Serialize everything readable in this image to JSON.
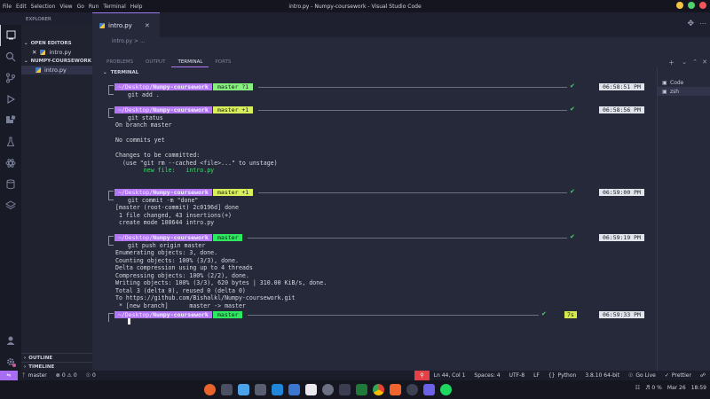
{
  "window": {
    "title": "intro.py - Numpy-coursework - Visual Studio Code"
  },
  "menu": [
    "File",
    "Edit",
    "Selection",
    "View",
    "Go",
    "Run",
    "Terminal",
    "Help"
  ],
  "sidebar": {
    "header": "EXPLORER",
    "open_editors_label": "OPEN EDITORS",
    "open_editor_file": "intro.py",
    "workspace_label": "NUMPY-COURSEWORK",
    "workspace_file": "intro.py",
    "outline_label": "OUTLINE",
    "timeline_label": "TIMELINE"
  },
  "editor": {
    "tab_label": "intro.py",
    "breadcrumb": "intro.py > ..."
  },
  "panel": {
    "tabs": [
      "PROBLEMS",
      "OUTPUT",
      "TERMINAL",
      "PORTS"
    ],
    "active_tab": "TERMINAL",
    "terminal_label": "TERMINAL",
    "terminal_list": [
      "Code",
      "zsh"
    ]
  },
  "terminal": {
    "prompt_dir_prefix": "~/Desktop/",
    "prompt_dir_repo": "Numpy-coursework",
    "blocks": [
      {
        "git": "master ?1",
        "git_color": "#86f07c",
        "time": "06:58:51 PM",
        "command": "git add .",
        "output": []
      },
      {
        "git": "master +1",
        "git_color": "#d8ef5a",
        "time": "06:58:56 PM",
        "command": "git status",
        "output": [
          "On branch master",
          "",
          "No commits yet",
          "",
          "Changes to be committed:",
          "  (use \"git rm --cached <file>...\" to unstage)",
          "        new file:   intro.py"
        ]
      },
      {
        "git": "master +1",
        "git_color": "#d8ef5a",
        "time": "06:59:00 PM",
        "command": "git commit -m \"done\"",
        "output": [
          "[master (root-commit) 2c0196d] done",
          " 1 file changed, 43 insertions(+)",
          " create mode 100644 intro.py"
        ]
      },
      {
        "git": "master",
        "git_color": "#2ee85f",
        "time": "06:59:19 PM",
        "command": "git push origin master",
        "output": [
          "Enumerating objects: 3, done.",
          "Counting objects: 100% (3/3), done.",
          "Delta compression using up to 4 threads",
          "Compressing objects: 100% (2/2), done.",
          "Writing objects: 100% (3/3), 620 bytes | 310.00 KiB/s, done.",
          "Total 3 (delta 0), reused 0 (delta 0)",
          "To https://github.com/Bishalkl/Numpy-coursework.git",
          " * [new branch]      master -> master"
        ]
      },
      {
        "git": "master",
        "git_color": "#2ee85f",
        "time": "06:59:33 PM",
        "duration": "7s",
        "command": "",
        "output": []
      }
    ]
  },
  "statusbar": {
    "branch": "master",
    "problems": "0 ⚠ 0",
    "ports": "0",
    "position": "Ln 44, Col 1",
    "spaces": "Spaces: 4",
    "encoding": "UTF-8",
    "eol": "LF",
    "language": "Python",
    "interpreter": "3.8.10 64-bit",
    "golive": "Go Live",
    "prettier": "Prettier"
  },
  "taskbar": {
    "volume": "0 %",
    "date": "Mar 26",
    "time": "18:59"
  },
  "colors": {
    "accent": "#b276f3",
    "error": "#e34048",
    "ok": "#3fd968"
  }
}
